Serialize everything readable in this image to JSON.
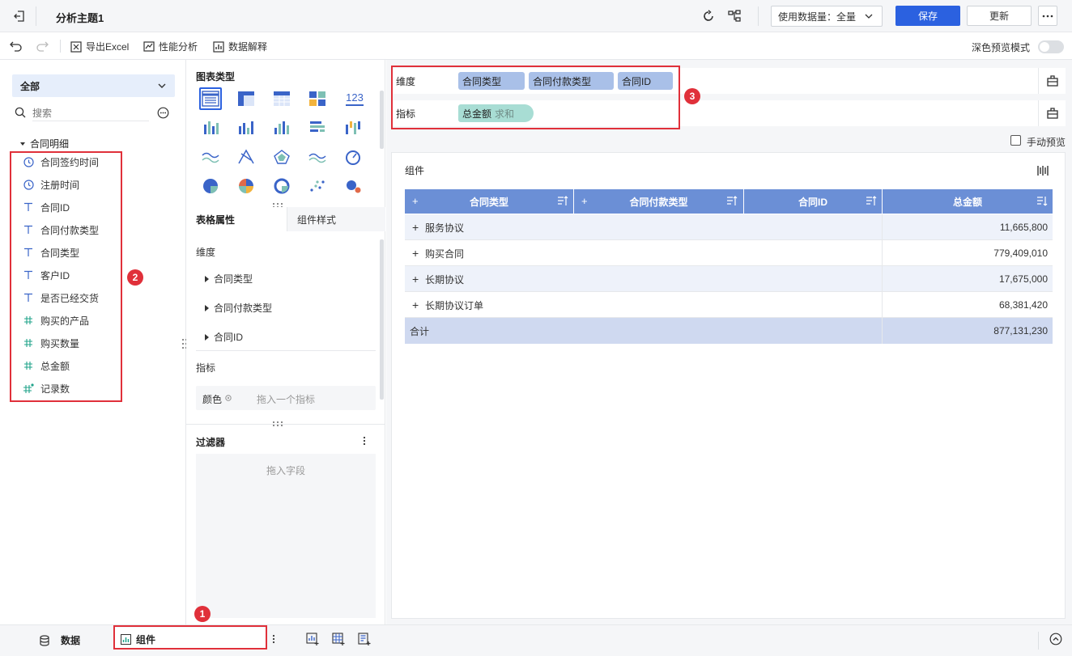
{
  "header": {
    "title": "分析主题1",
    "data_volume_label": "使用数据量：全量",
    "save_label": "保存",
    "update_label": "更新"
  },
  "toolbar": {
    "export_label": "导出Excel",
    "perf_label": "性能分析",
    "explain_label": "数据解释",
    "dark_mode_label": "深色预览模式"
  },
  "fields": {
    "scope": "全部",
    "search_placeholder": "搜索",
    "group_name": "合同明细",
    "items": [
      {
        "label": "合同签约时间",
        "icon": "clock-icon"
      },
      {
        "label": "注册时间",
        "icon": "clock-icon"
      },
      {
        "label": "合同ID",
        "icon": "text-type-icon"
      },
      {
        "label": "合同付款类型",
        "icon": "text-type-icon"
      },
      {
        "label": "合同类型",
        "icon": "text-type-icon"
      },
      {
        "label": "客户ID",
        "icon": "text-type-icon"
      },
      {
        "label": "是否已经交货",
        "icon": "text-type-icon"
      },
      {
        "label": "购买的产品",
        "icon": "number-type-icon"
      },
      {
        "label": "购买数量",
        "icon": "number-type-icon"
      },
      {
        "label": "总金额",
        "icon": "number-type-icon"
      },
      {
        "label": "记录数",
        "icon": "number-type-icon"
      }
    ]
  },
  "config": {
    "chart_type_title": "图表类型",
    "number_chart_text": "123",
    "tab_table_props": "表格属性",
    "tab_component_style": "组件样式",
    "dimension_title": "维度",
    "dimensions": [
      "合同类型",
      "合同付款类型",
      "合同ID"
    ],
    "metric_title": "指标",
    "color_label": "颜色",
    "drop_metric_placeholder": "拖入一个指标",
    "filter_title": "过滤器",
    "drop_field_placeholder": "拖入字段"
  },
  "shelf": {
    "dimension_label": "维度",
    "dimension_pills": [
      "合同类型",
      "合同付款类型",
      "合同ID"
    ],
    "metric_label": "指标",
    "metric_pill": "总金额",
    "metric_agg": "求和",
    "manual_preview_label": "手动预览"
  },
  "widget": {
    "title": "组件",
    "columns": [
      "合同类型",
      "合同付款类型",
      "合同ID",
      "总金额"
    ],
    "rows": [
      {
        "type": "服务协议",
        "amount": "11,665,800"
      },
      {
        "type": "购买合同",
        "amount": "779,409,010"
      },
      {
        "type": "长期协议",
        "amount": "17,675,000"
      },
      {
        "type": "长期协议订单",
        "amount": "68,381,420"
      }
    ],
    "total_label": "合计",
    "total_amount": "877,131,230"
  },
  "bottom": {
    "data_tab": "数据",
    "component_tab": "组件"
  },
  "badges": [
    "1",
    "2",
    "3"
  ],
  "colors": {
    "primary": "#2b61e0",
    "header_blue": "#6b8fd6",
    "dimension_pill": "#a9c0e8",
    "metric_pill": "#a8ddd4",
    "annotation_red": "#e0303a"
  }
}
